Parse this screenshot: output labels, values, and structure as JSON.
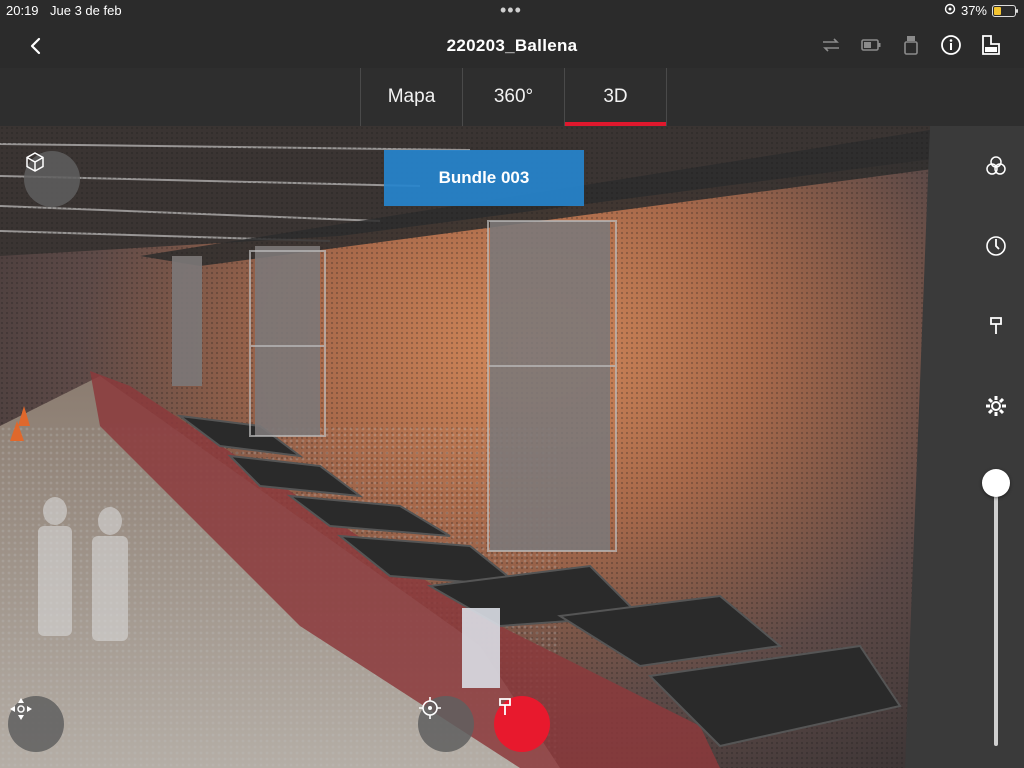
{
  "status": {
    "time": "20:19",
    "date": "Jue 3 de feb",
    "battery": "37%",
    "battery_level": 0.37,
    "dots": "•••"
  },
  "header": {
    "title": "220203_Ballena",
    "back_icon": "chevron-left-icon"
  },
  "toolbar_icons": [
    "sync-icon",
    "battery-scanner-icon",
    "scanner-icon",
    "info-icon",
    "layers-icon"
  ],
  "tabs": [
    {
      "label": "Mapa",
      "active": false
    },
    {
      "label": "360°",
      "active": false
    },
    {
      "label": "3D",
      "active": true
    }
  ],
  "viewport": {
    "bundle_label": "Bundle 003"
  },
  "side_panel": {
    "icons": [
      "circles-icon",
      "compass-icon",
      "pin-icon",
      "gear-icon"
    ],
    "slider_value": 1.0
  },
  "colors": {
    "accent_red": "#e8192d",
    "bundle_blue": "#2684cd"
  }
}
